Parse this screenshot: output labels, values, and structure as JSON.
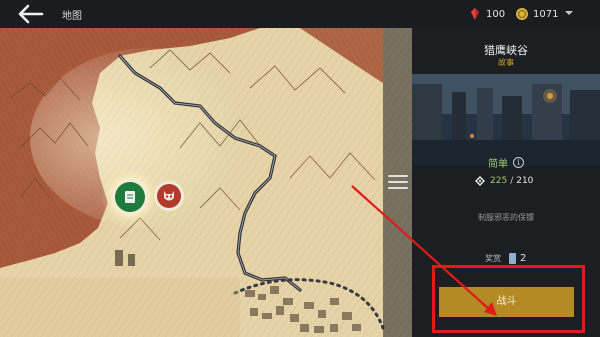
{
  "topbar": {
    "title": "地图",
    "resources": [
      {
        "icon": "red-gem-icon",
        "value": "100",
        "color": "#c42a2a"
      },
      {
        "icon": "gold-coin-icon",
        "value": "1071",
        "color": "#d8b640"
      }
    ]
  },
  "location": {
    "name": "猎鹰峡谷",
    "subtitle": "故事",
    "difficulty": "简单",
    "power_current": "225",
    "power_required": "210",
    "description": "制服邪恶的保镖",
    "reward_label": "奖赏",
    "reward_count": "2",
    "action_label": "战斗"
  },
  "colors": {
    "accent": "#b38a24",
    "difficulty": "#9ec96b",
    "annotation": "#e11a1a",
    "story_marker": "#1f7a3e",
    "enemy_marker": "#b13a2c"
  },
  "icons": {
    "back": "back-arrow-icon",
    "menu": "hamburger-menu-icon",
    "story_marker": "story-scroll-icon",
    "enemy_marker": "demon-mask-icon",
    "info": "info-icon",
    "power": "power-diamond-icon",
    "reward": "card-icon"
  }
}
